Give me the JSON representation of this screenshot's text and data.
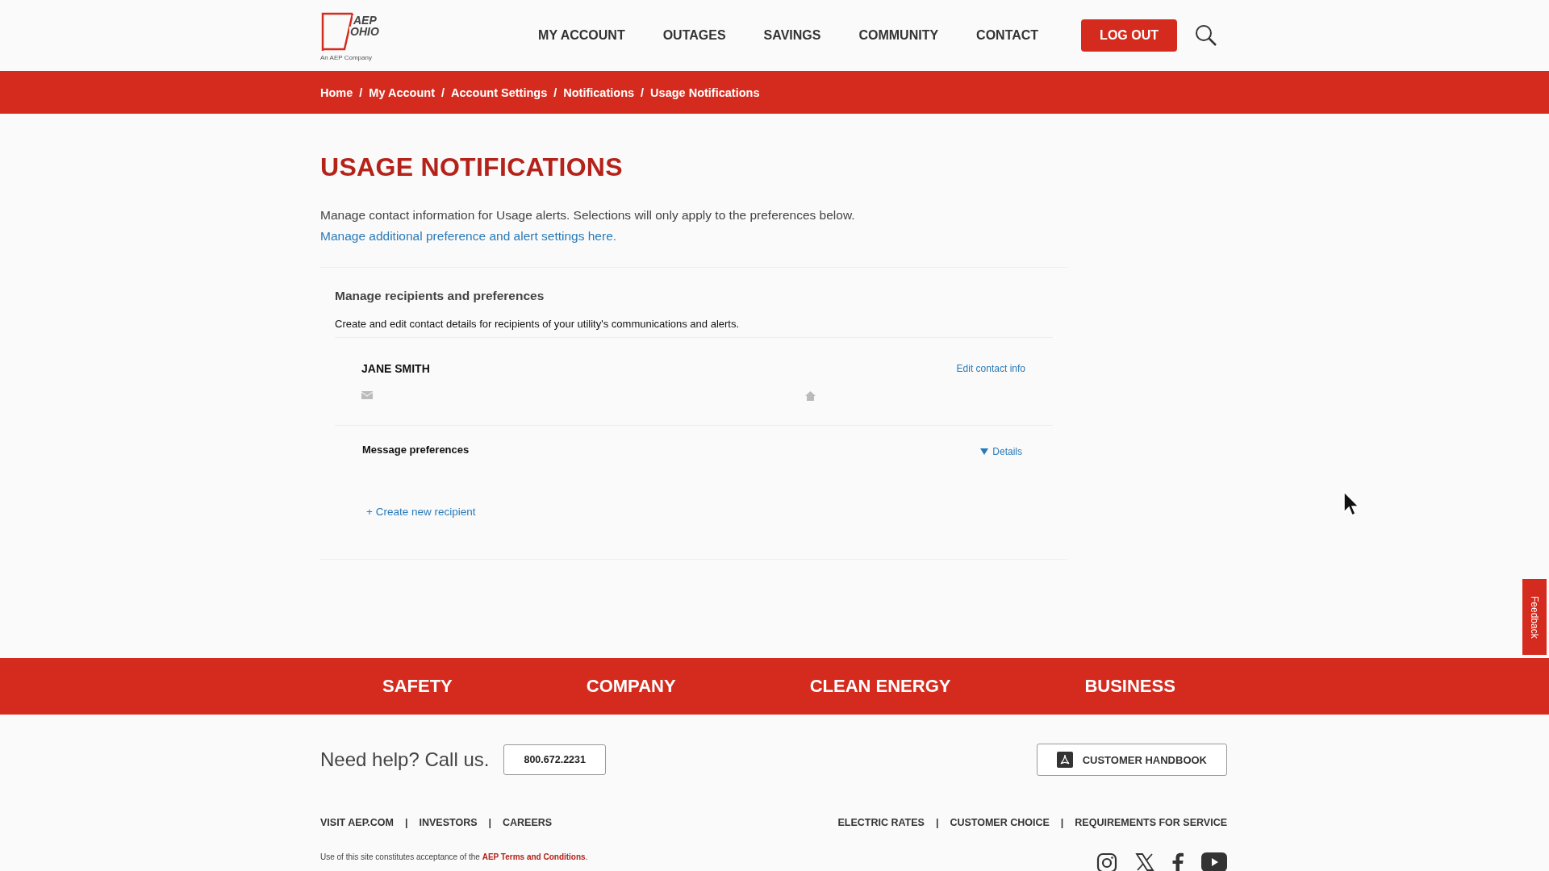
{
  "logo": {
    "line_1": "AEP",
    "line_2": "OHIO",
    "tagline": "An AEP Company"
  },
  "nav": [
    "MY ACCOUNT",
    "OUTAGES",
    "SAVINGS",
    "COMMUNITY",
    "CONTACT"
  ],
  "logout": "LOG OUT",
  "breadcrumb_separator": "/",
  "link_separator": "|",
  "breadcrumbs": [
    "Home",
    "My Account",
    "Account Settings",
    "Notifications",
    "Usage Notifications"
  ],
  "page_title": "USAGE NOTIFICATIONS",
  "intro": {
    "text": "Manage contact information for Usage alerts. Selections will only apply to the preferences below.",
    "link": "Manage additional preference and alert settings here."
  },
  "card": {
    "title": "Manage recipients and preferences",
    "description": "Create and edit contact details for recipients of your utility's communications and alerts.",
    "recipient": {
      "name": "JANE SMITH",
      "edit_link": "Edit contact info"
    },
    "preferences": {
      "label": "Message preferences",
      "toggle": "Details"
    },
    "create_link": "+ Create new recipient"
  },
  "footer_nav": [
    "SAFETY",
    "COMPANY",
    "CLEAN ENERGY",
    "BUSINESS"
  ],
  "help": {
    "text": "Need help? Call us.",
    "phone": "800.672.2231",
    "handbook": "CUSTOMER HANDBOOK"
  },
  "links_left": [
    "VISIT AEP.COM",
    "INVESTORS",
    "CAREERS"
  ],
  "links_right": [
    "ELECTRIC RATES",
    "CUSTOMER CHOICE",
    "REQUIREMENTS FOR SERVICE"
  ],
  "legal": {
    "text": "Use of this site constitutes acceptance of the",
    "link": "AEP Terms and Conditions",
    "end": "."
  },
  "feedback": "Feedback"
}
